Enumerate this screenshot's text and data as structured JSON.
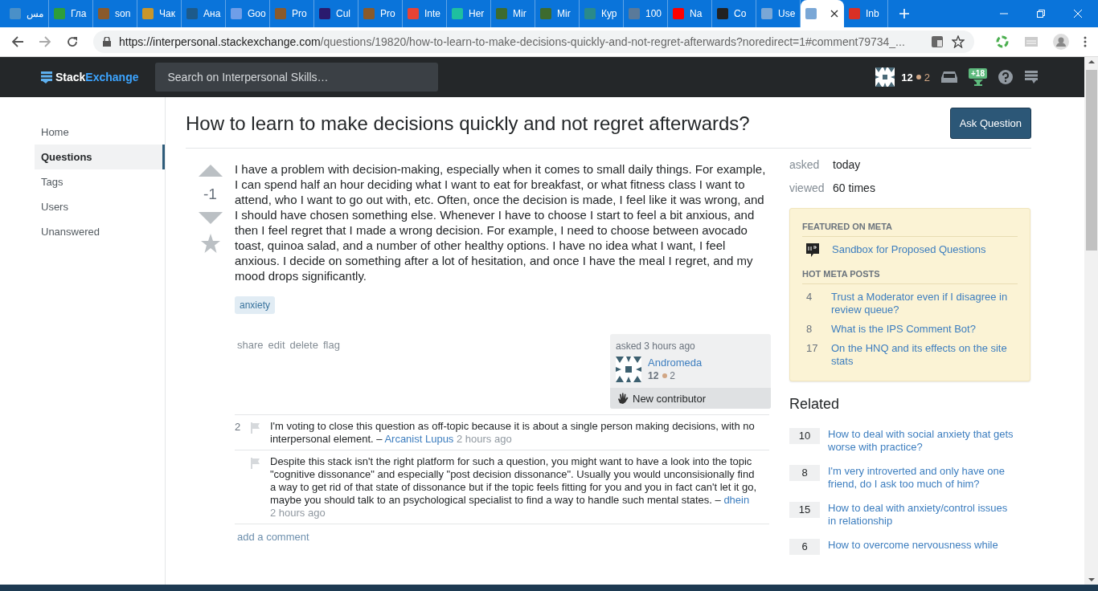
{
  "browser": {
    "tabs": [
      {
        "title": "مس",
        "color": "#4a90c8",
        "selected": false
      },
      {
        "title": "Гла",
        "color": "#2e9e3a",
        "selected": false
      },
      {
        "title": "son",
        "color": "#8a5a2b",
        "selected": false
      },
      {
        "title": "Чак",
        "color": "#c8962a",
        "selected": false
      },
      {
        "title": "Ана",
        "color": "#1d5a8a",
        "selected": false
      },
      {
        "title": "Goo",
        "color": "#6f9ee8",
        "selected": false
      },
      {
        "title": "Pro",
        "color": "#8a5a2b",
        "selected": false
      },
      {
        "title": "Cul",
        "color": "#2a1a6e",
        "selected": false
      },
      {
        "title": "Pro",
        "color": "#8a5a2b",
        "selected": false
      },
      {
        "title": "Inte",
        "color": "#e84335",
        "selected": false
      },
      {
        "title": "Her",
        "color": "#1fbfa0",
        "selected": false
      },
      {
        "title": "Mir",
        "color": "#3d6b2e",
        "selected": false
      },
      {
        "title": "Mir",
        "color": "#3d6b2e",
        "selected": false
      },
      {
        "title": "Кур",
        "color": "#2a8a8a",
        "selected": false
      },
      {
        "title": "100",
        "color": "#5a7a9a",
        "selected": false
      },
      {
        "title": "Na",
        "color": "#ff0000",
        "selected": false
      },
      {
        "title": "Co",
        "color": "#222222",
        "selected": false
      },
      {
        "title": "Use",
        "color": "#7aa7d6",
        "selected": false
      },
      {
        "color": "#7aa7d6",
        "selected": true
      },
      {
        "title": "Inb",
        "color": "#d93025",
        "selected": false
      }
    ],
    "url_host": "https://interpersonal.stackexchange.com",
    "url_path": "/questions/19820/how-to-learn-to-make-decisions-quickly-and-not-regret-afterwards?noredirect=1#comment79734_..."
  },
  "header": {
    "logo_left": "Stack",
    "logo_right": "Exchange",
    "search": {
      "placeholder": "Search on Interpersonal Skills…"
    },
    "reputation": "12",
    "bronze": "2",
    "achievements": "+18"
  },
  "sidebar": {
    "items": [
      {
        "label": "Home",
        "selected": false
      },
      {
        "label": "Questions",
        "selected": true
      },
      {
        "label": "Tags",
        "selected": false
      },
      {
        "label": "Users",
        "selected": false
      },
      {
        "label": "Unanswered",
        "selected": false
      }
    ]
  },
  "question": {
    "title": "How to learn to make decisions quickly and not regret afterwards?",
    "ask_button": "Ask Question",
    "votes": "-1",
    "body": "I have a problem with decision-making, especially when it comes to small daily things. For example, I can spend half an hour deciding what I want to eat for breakfast, or what fitness class I want to attend, who I want to go out with, etc. Often, once the decision is made, I feel like it was wrong, and I should have chosen something else. Whenever I have to choose I start to feel a bit anxious, and then I feel regret that I made a wrong decision. For example, I need to choose between avocado toast, quinoa salad, and a number of other healthy options. I have no idea what I want, I feel anxious. I decide on something after a lot of hesitation, and once I have the meal I regret, and my mood drops significantly.",
    "tags": [
      "anxiety"
    ],
    "actions": [
      "share",
      "edit",
      "delete",
      "flag"
    ],
    "owner": {
      "asked": "asked 3 hours ago",
      "name": "Andromeda",
      "reputation": "12",
      "bronze": "2",
      "badge": "New contributor"
    },
    "comments": [
      {
        "score": "2",
        "text": "I'm voting to close this question as off-topic because it is about a single person making decisions, with no interpersonal element. –",
        "author": "Arcanist Lupus",
        "time": "2 hours ago"
      },
      {
        "text": "Despite this stack isn't the right platform for such a question, you might want to have a look into the topic \"cognitive dissonance\" and especially \"post decision dissonance\". Usually you would unconsisionally find a way to get rid of that state of dissonance but if the topic feels fitting for you and you in fact can't let it go, maybe you should talk to an psychological specialist to find a way to handle such mental states. –",
        "author": "dhein",
        "time": "2 hours ago"
      }
    ],
    "add_comment": "add a comment"
  },
  "stats": [
    {
      "label": "asked",
      "value": "today"
    },
    {
      "label": "viewed",
      "value": "60 times"
    }
  ],
  "meta_box": {
    "featured_heading": "FEATURED ON META",
    "featured": [
      "Sandbox for Proposed Questions"
    ],
    "hot_heading": "HOT META POSTS",
    "hot": [
      {
        "count": "4",
        "title": "Trust a Moderator even if I disagree in review queue?"
      },
      {
        "count": "8",
        "title": "What is the IPS Comment Bot?"
      },
      {
        "count": "17",
        "title": "On the HNQ and its effects on the site stats"
      }
    ]
  },
  "related": {
    "heading": "Related",
    "items": [
      {
        "score": "10",
        "title": "How to deal with social anxiety that gets worse with practice?"
      },
      {
        "score": "8",
        "title": "I'm very introverted and only have one friend, do I ask too much of him?"
      },
      {
        "score": "15",
        "title": "How to deal with anxiety/control issues in relationship"
      },
      {
        "score": "6",
        "title": "How to overcome nervousness while"
      }
    ]
  }
}
